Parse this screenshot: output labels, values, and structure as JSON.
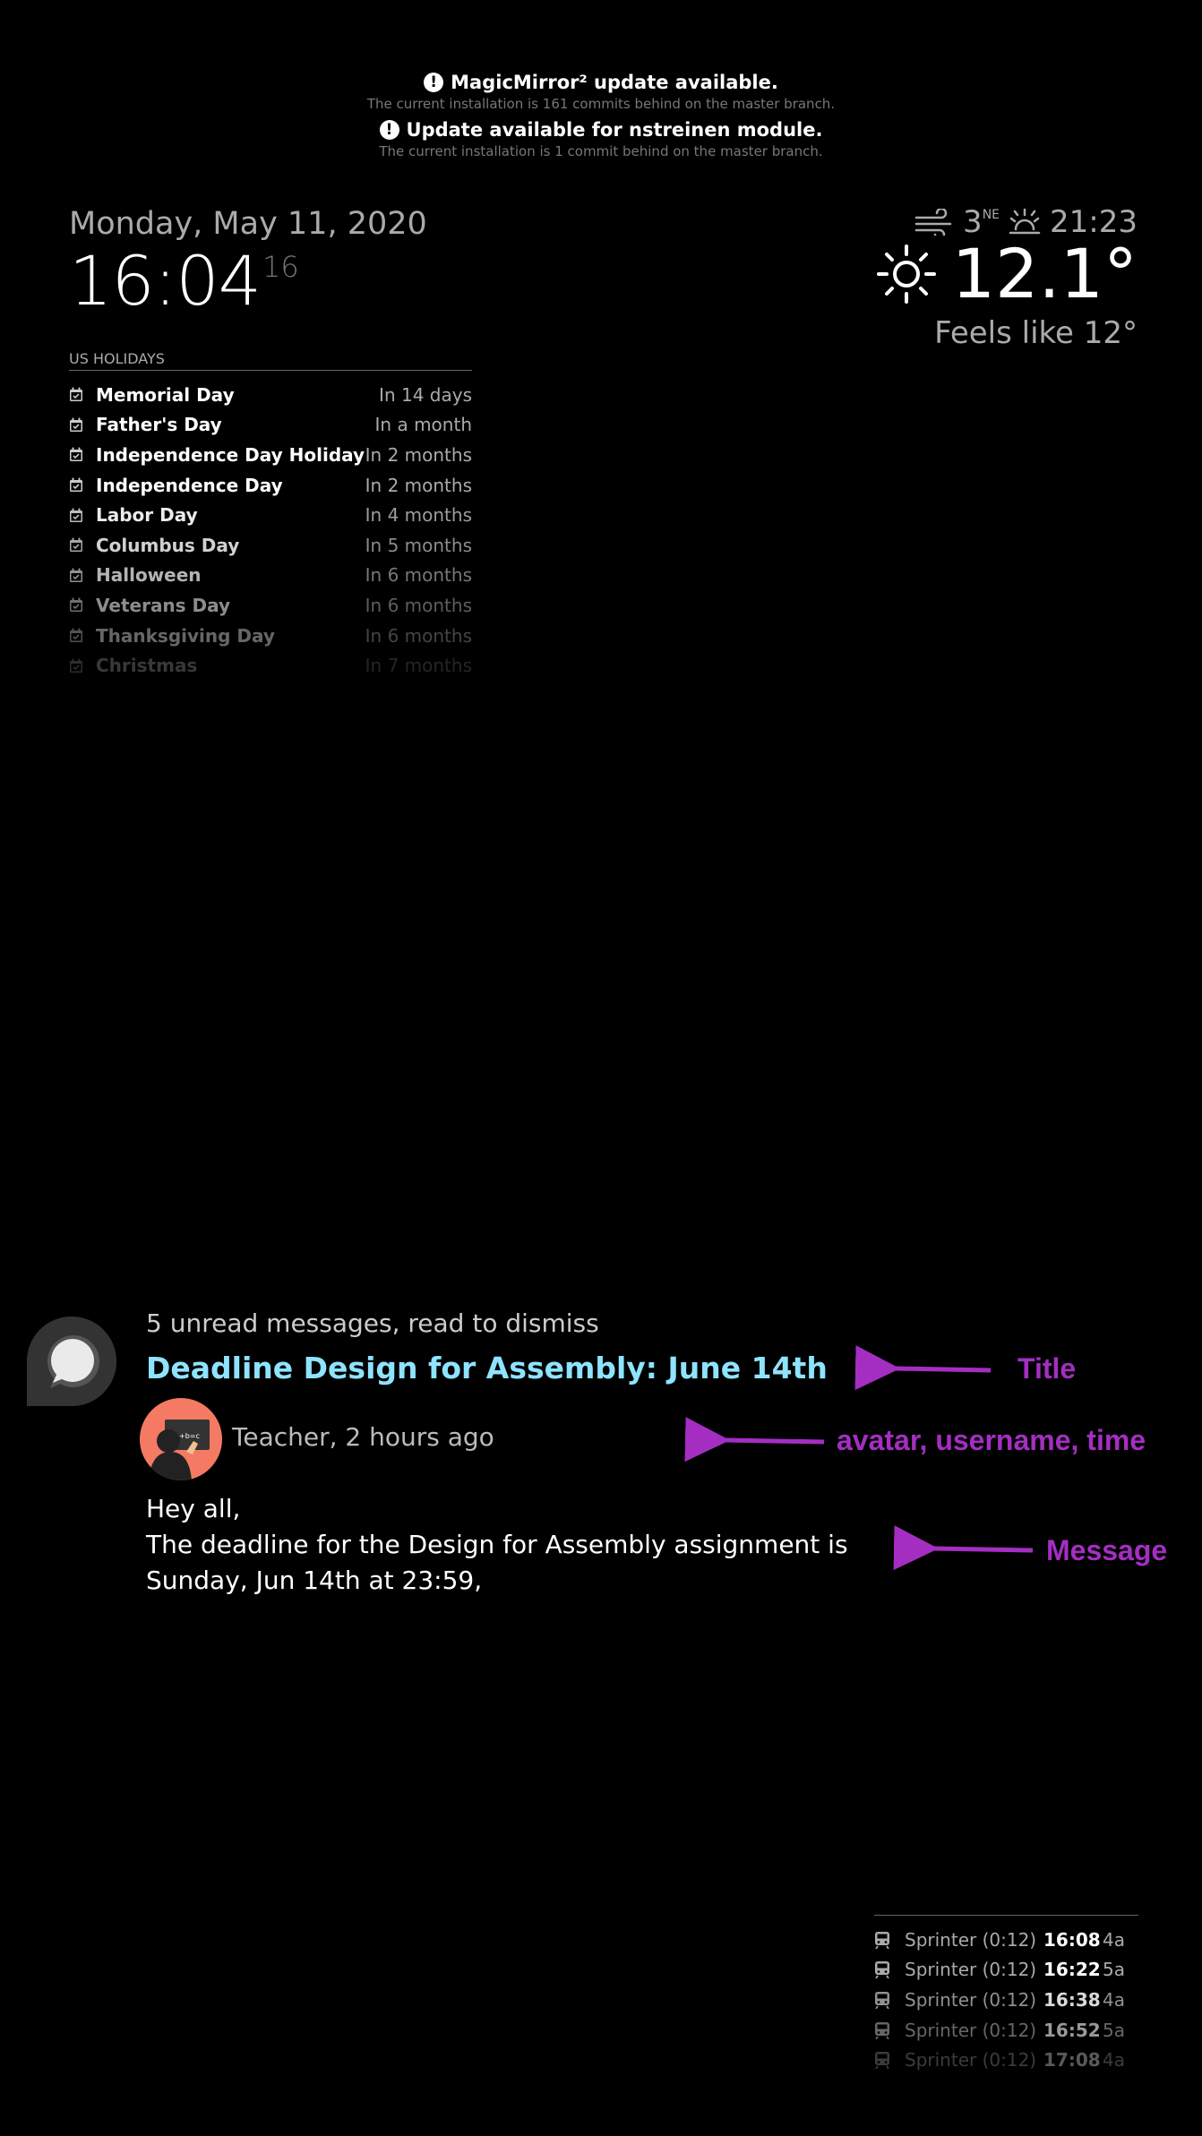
{
  "updates": [
    {
      "title": "MagicMirror² update available.",
      "subtitle": "The current installation is 161 commits behind on the master branch."
    },
    {
      "title": "Update available for nstreinen module.",
      "subtitle": "The current installation is 1 commit behind on the master branch."
    }
  ],
  "clock": {
    "date": "Monday, May 11, 2020",
    "time": "16:04",
    "seconds": "16"
  },
  "calendar": {
    "header": "US HOLIDAYS",
    "events": [
      {
        "title": "Memorial Day",
        "time": "In 14 days"
      },
      {
        "title": "Father's Day",
        "time": "In a month"
      },
      {
        "title": "Independence Day Holiday",
        "time": "In 2 months"
      },
      {
        "title": "Independence Day",
        "time": "In 2 months"
      },
      {
        "title": "Labor Day",
        "time": "In 4 months"
      },
      {
        "title": "Columbus Day",
        "time": "In 5 months"
      },
      {
        "title": "Halloween",
        "time": "In 6 months"
      },
      {
        "title": "Veterans Day",
        "time": "In 6 months"
      },
      {
        "title": "Thanksgiving Day",
        "time": "In 6 months"
      },
      {
        "title": "Christmas",
        "time": "In 7 months"
      }
    ]
  },
  "weather": {
    "wind_speed": "3",
    "wind_direction": "NE",
    "sunset_time": "21:23",
    "temperature": "12.1°",
    "feels_like": "Feels like 12°",
    "wind_icon": "wind-icon",
    "sunset_icon": "sunset-icon",
    "condition_icon": "sun-icon"
  },
  "message": {
    "unread": "5 unread messages, read to dismiss",
    "title": "Deadline Design for Assembly: June 14th",
    "meta": "Teacher, 2 hours ago",
    "body_lines": [
      "Hey all,",
      "The deadline for the Design for Assembly assignment is",
      "Sunday, Jun 14th at 23:59,"
    ],
    "avatar_text": "a+b=c"
  },
  "annotations": {
    "title": "Title",
    "meta": "avatar, username, time",
    "message": "Message",
    "color": "#a42ec2"
  },
  "trains": [
    {
      "name": "Sprinter (0:12)",
      "time": "16:08",
      "track": "4a"
    },
    {
      "name": "Sprinter (0:12)",
      "time": "16:22",
      "track": "5a"
    },
    {
      "name": "Sprinter (0:12)",
      "time": "16:38",
      "track": "4a"
    },
    {
      "name": "Sprinter (0:12)",
      "time": "16:52",
      "track": "5a"
    },
    {
      "name": "Sprinter (0:12)",
      "time": "17:08",
      "track": "4a"
    }
  ]
}
